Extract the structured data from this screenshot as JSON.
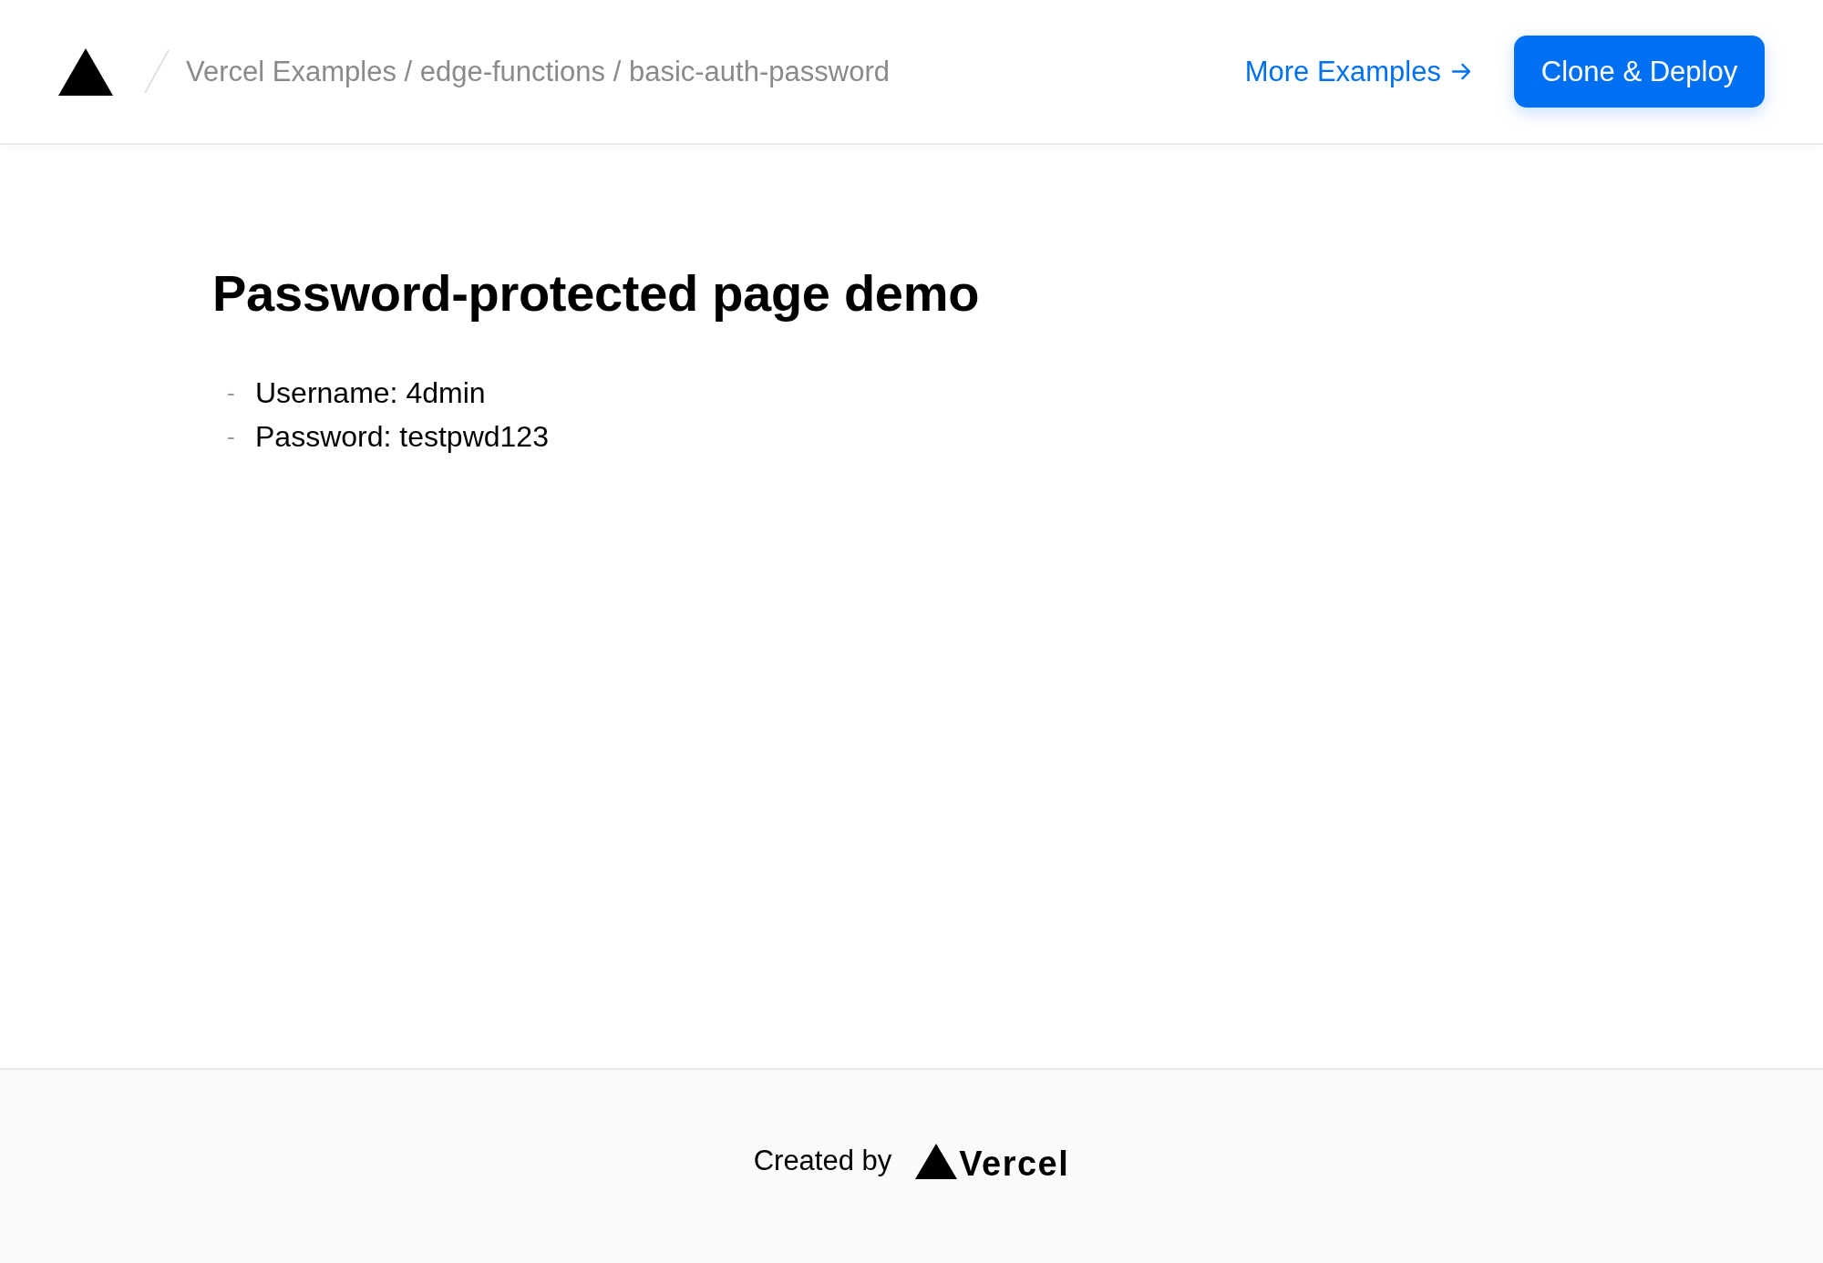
{
  "header": {
    "breadcrumb": "Vercel Examples / edge-functions / basic-auth-password",
    "link": "More Examples",
    "button": "Clone & Deploy"
  },
  "main": {
    "title": "Password-protected page demo",
    "items": [
      {
        "marker": "-",
        "text": "Username: 4dmin"
      },
      {
        "marker": "-",
        "text": "Password: testpwd123"
      }
    ]
  },
  "footer": {
    "label": "Created by",
    "brand": "Vercel"
  }
}
